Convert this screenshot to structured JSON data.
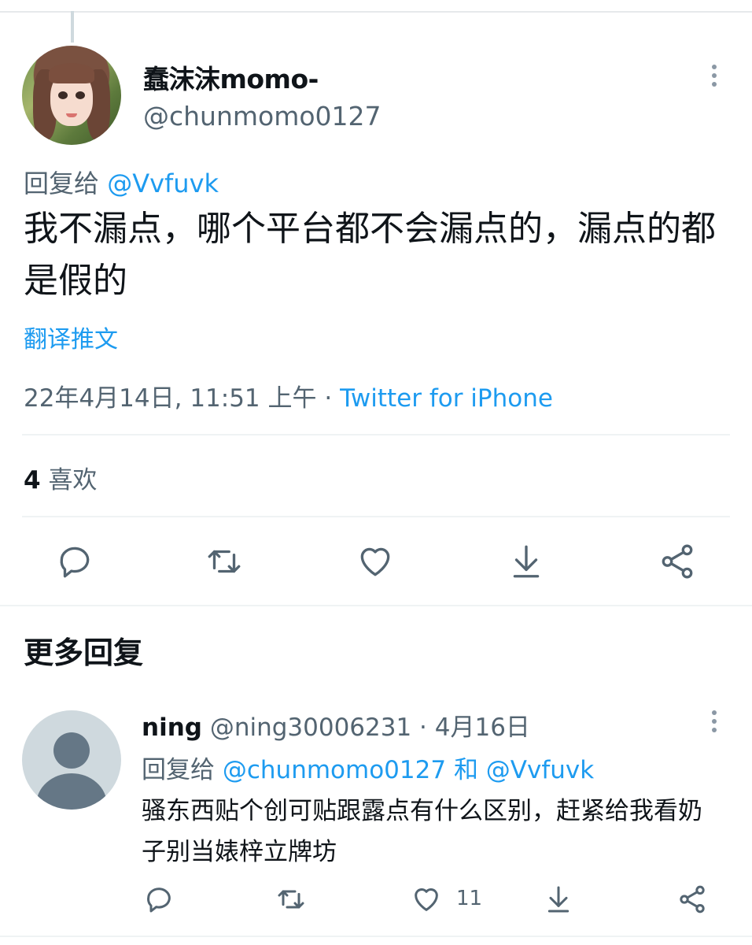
{
  "tweet": {
    "display_name": "蠢沫沫momo-",
    "handle": "@chunmomo0127",
    "reply_prefix": "回复给",
    "reply_mention": "@Vvfuvk",
    "text": "我不漏点，哪个平台都不会漏点的，漏点的都是假的",
    "translate_label": "翻译推文",
    "timestamp": "22年4月14日, 11:51 上午",
    "separator": " · ",
    "source": "Twitter for iPhone",
    "likes_count": "4",
    "likes_label": "喜欢",
    "actions": [
      "reply-icon",
      "retweet-icon",
      "like-icon",
      "bookmark-download-icon",
      "share-icon"
    ]
  },
  "section": {
    "more_replies_title": "更多回复"
  },
  "reply": {
    "name": "ning",
    "handle": "@ning30006231",
    "separator": " · ",
    "date": "4月16日",
    "reply_prefix": "回复给",
    "mention1": "@chunmomo0127",
    "conjunction": "和",
    "mention2": "@Vvfuvk",
    "text": "骚东西贴个创可贴跟露点有什么区别，赶紧给我看奶子别当婊梓立牌坊",
    "like_count": "11"
  },
  "colors": {
    "accent": "#1d9bf0",
    "secondary_text": "#536471",
    "primary_text": "#0f1419",
    "divider": "#eff3f4"
  }
}
